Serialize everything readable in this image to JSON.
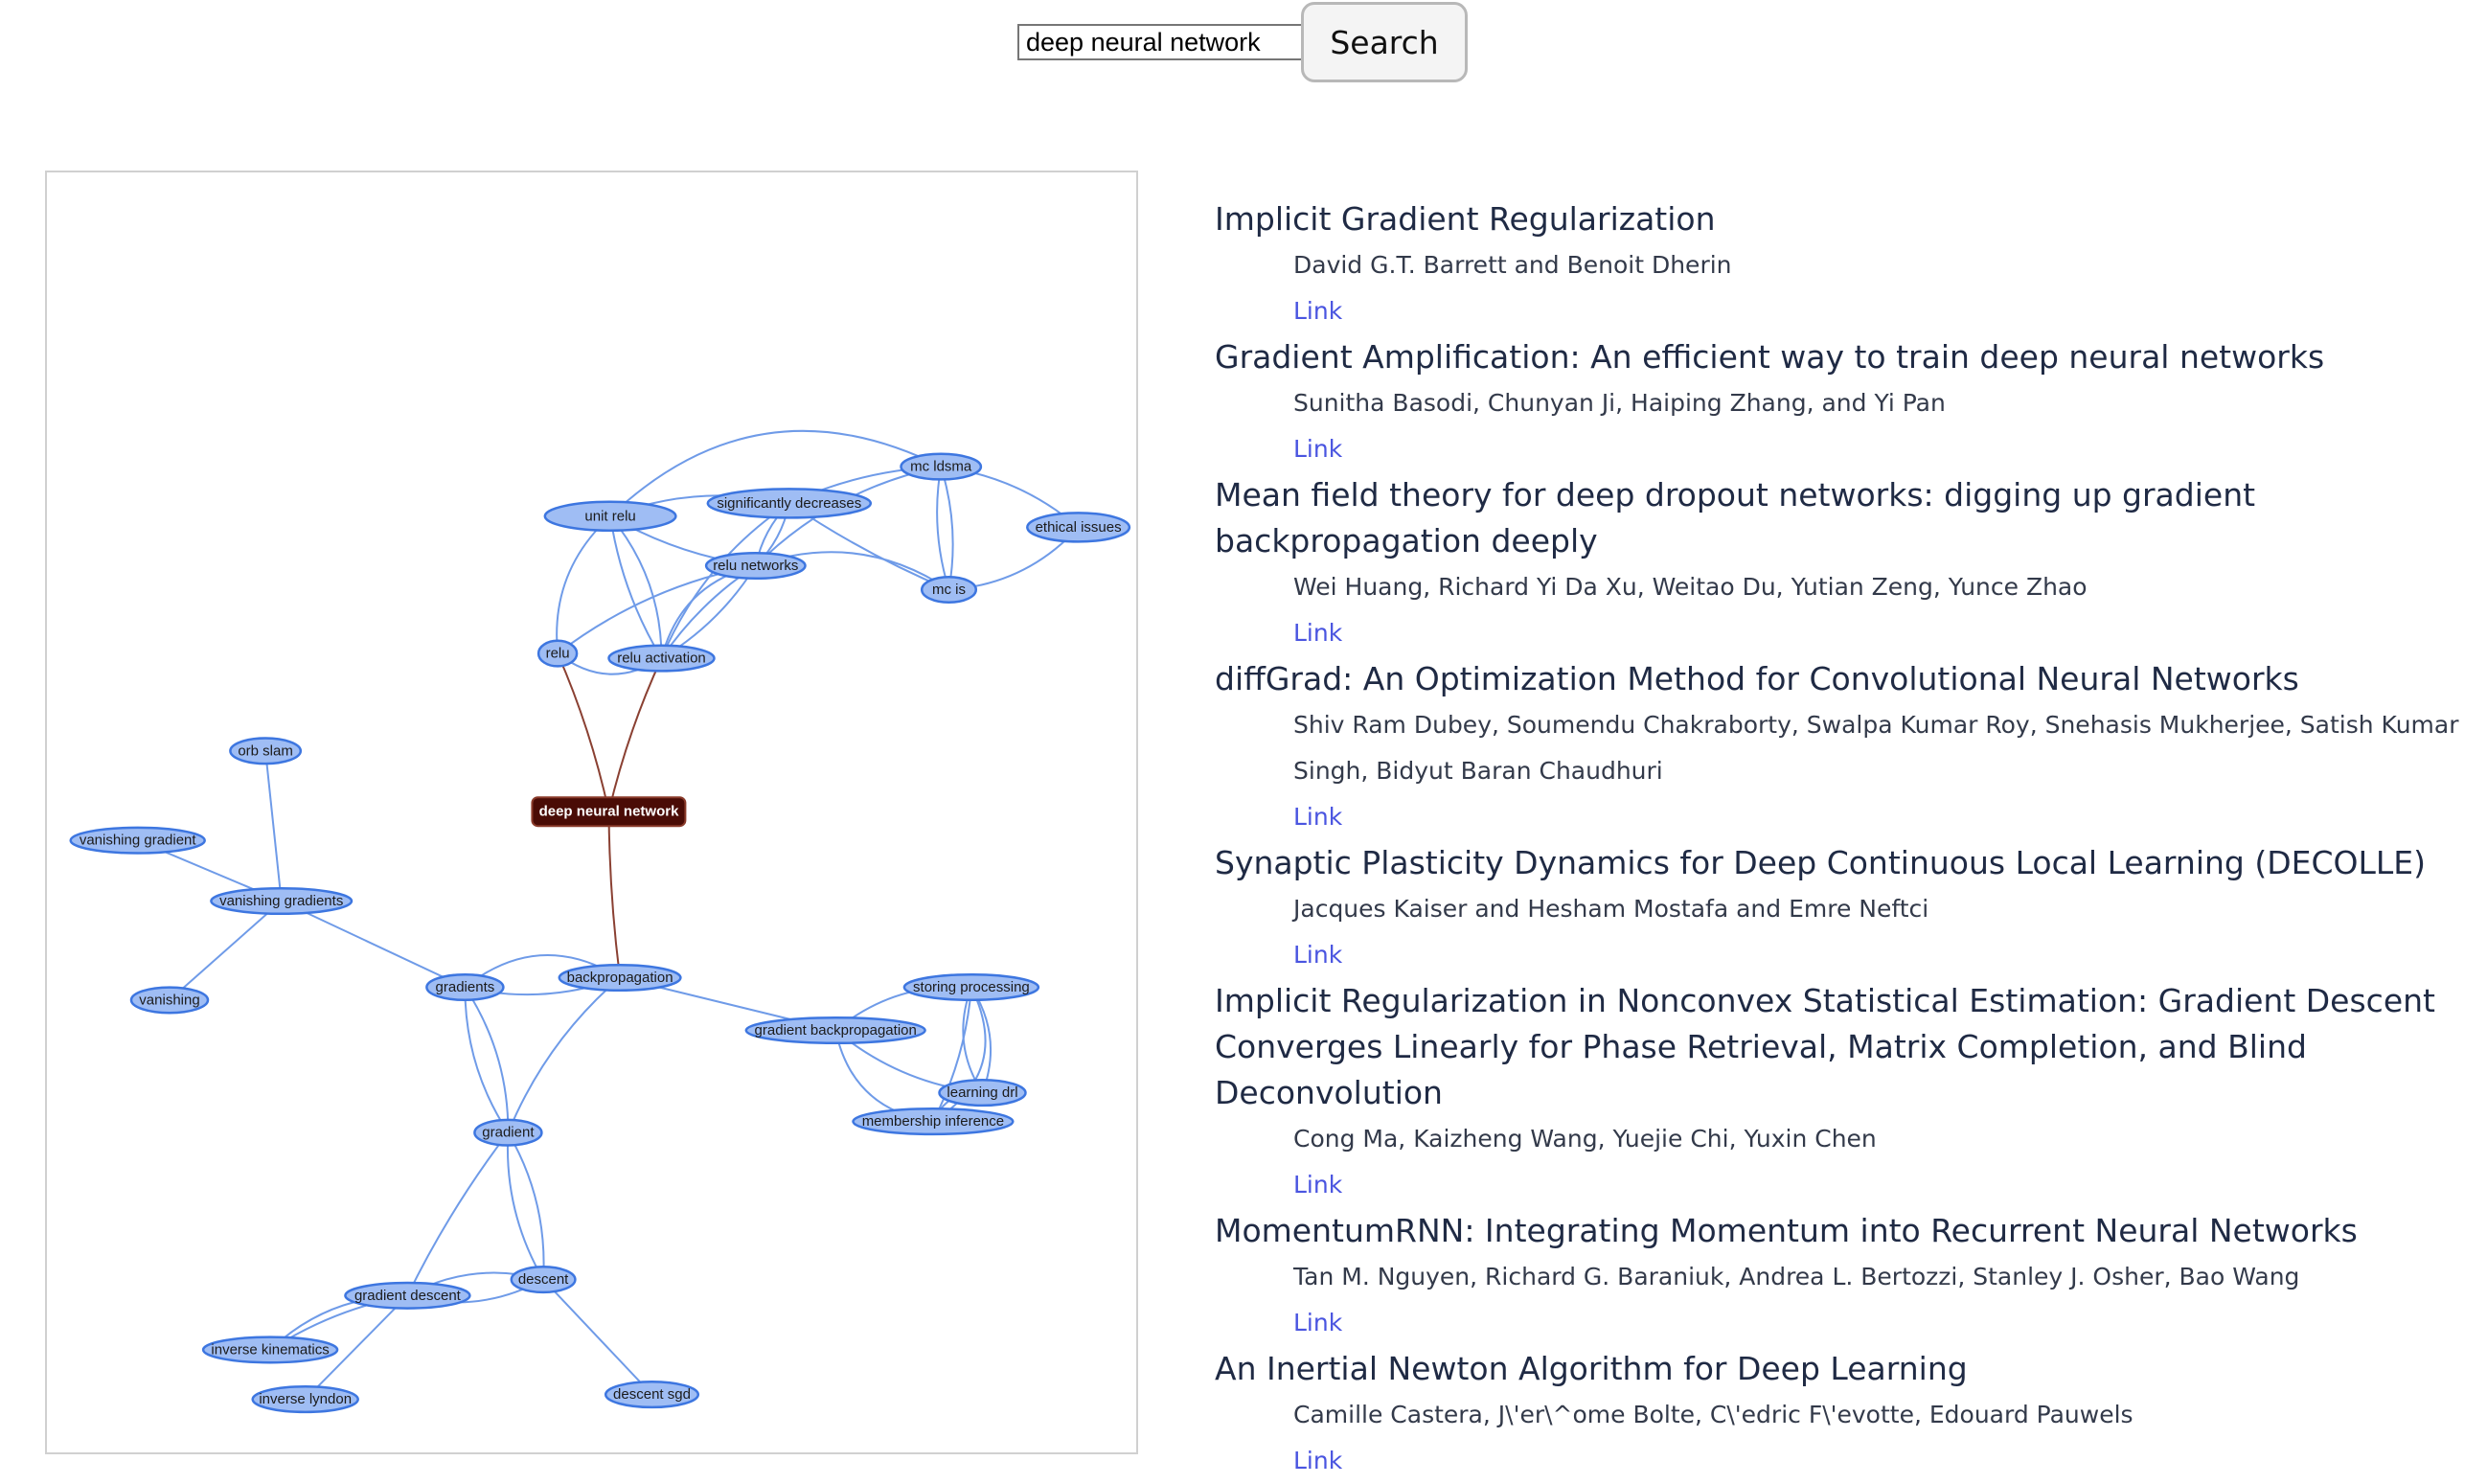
{
  "search": {
    "query": "deep neural network",
    "button_label": "Search"
  },
  "graph": {
    "focus_label": "deep neural network",
    "nodes": {
      "unit_relu": "unit relu",
      "significantly_decreases": "significantly decreases",
      "mc_ldsma": "mc ldsma",
      "ethical_issues": "ethical issues",
      "relu_networks": "relu networks",
      "mc_is": "mc is",
      "relu": "relu",
      "relu_activation": "relu activation",
      "orb_slam": "orb slam",
      "vanishing_gradient": "vanishing gradient",
      "vanishing_gradients": "vanishing gradients",
      "vanishing": "vanishing",
      "gradients": "gradients",
      "backpropagation": "backpropagation",
      "storing_processing": "storing processing",
      "gradient_backpropagation": "gradient backpropagation",
      "learning_drl": "learning drl",
      "membership_inference": "membership inference",
      "gradient": "gradient",
      "descent": "descent",
      "gradient_descent": "gradient descent",
      "inverse_kinematics": "inverse kinematics",
      "inverse_lyndon": "inverse lyndon",
      "descent_sgd": "descent sgd"
    }
  },
  "results": [
    {
      "title": "Implicit Gradient Regularization",
      "authors": "David G.T. Barrett and Benoit Dherin",
      "link": "Link"
    },
    {
      "title": "Gradient Amplification: An efficient way to train deep neural networks",
      "authors": "Sunitha Basodi, Chunyan Ji, Haiping Zhang, and Yi Pan",
      "link": "Link"
    },
    {
      "title": "Mean field theory for deep dropout networks: digging up gradient backpropagation deeply",
      "authors": "Wei Huang, Richard Yi Da Xu, Weitao Du, Yutian Zeng, Yunce Zhao",
      "link": "Link"
    },
    {
      "title": "diffGrad: An Optimization Method for Convolutional Neural Networks",
      "authors": "Shiv Ram Dubey, Soumendu Chakraborty, Swalpa Kumar Roy, Snehasis Mukherjee, Satish Kumar Singh, Bidyut Baran Chaudhuri",
      "link": "Link"
    },
    {
      "title": "Synaptic Plasticity Dynamics for Deep Continuous Local Learning (DECOLLE)",
      "authors": "Jacques Kaiser and Hesham Mostafa and Emre Neftci",
      "link": "Link"
    },
    {
      "title": "Implicit Regularization in Nonconvex Statistical Estimation: Gradient Descent Converges Linearly for Phase Retrieval, Matrix Completion, and Blind Deconvolution",
      "authors": "Cong Ma, Kaizheng Wang, Yuejie Chi, Yuxin Chen",
      "link": "Link"
    },
    {
      "title": "MomentumRNN: Integrating Momentum into Recurrent Neural Networks",
      "authors": "Tan M. Nguyen, Richard G. Baraniuk, Andrea L. Bertozzi, Stanley J. Osher, Bao Wang",
      "link": "Link"
    },
    {
      "title": "An Inertial Newton Algorithm for Deep Learning",
      "authors": "Camille Castera, J\\'er\\^ome Bolte, C\\'edric F\\'evotte, Edouard Pauwels",
      "link": "Link"
    }
  ]
}
